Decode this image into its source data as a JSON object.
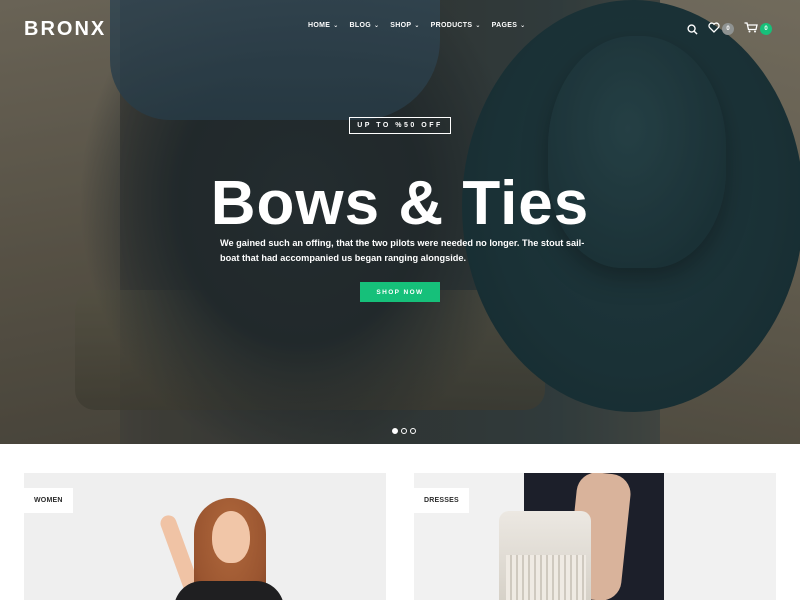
{
  "brand": {
    "logo_text": "BRONX"
  },
  "nav": {
    "items": [
      {
        "label": "HOME"
      },
      {
        "label": "BLOG"
      },
      {
        "label": "SHOP"
      },
      {
        "label": "PRODUCTS"
      },
      {
        "label": "PAGES"
      }
    ]
  },
  "header_icons": {
    "wishlist_count": "0",
    "cart_count": "0",
    "icons": [
      "search-icon",
      "heart-icon",
      "cart-icon"
    ]
  },
  "hero": {
    "promo_tag": "UP TO %50 OFF",
    "title": "Bows & Ties",
    "description": "We gained such an offing, that the two pilots were needed no longer. The stout sail-boat that had accompanied us began ranging alongside.",
    "cta_label": "SHOP NOW",
    "slider": {
      "total_slides": 3,
      "active_slide": 1
    }
  },
  "categories": [
    {
      "label": "WOMEN"
    },
    {
      "label": "DRESSES"
    }
  ],
  "colors": {
    "accent": "#16c07a",
    "badge_grey": "#8f9392",
    "text_white": "#ffffff"
  }
}
